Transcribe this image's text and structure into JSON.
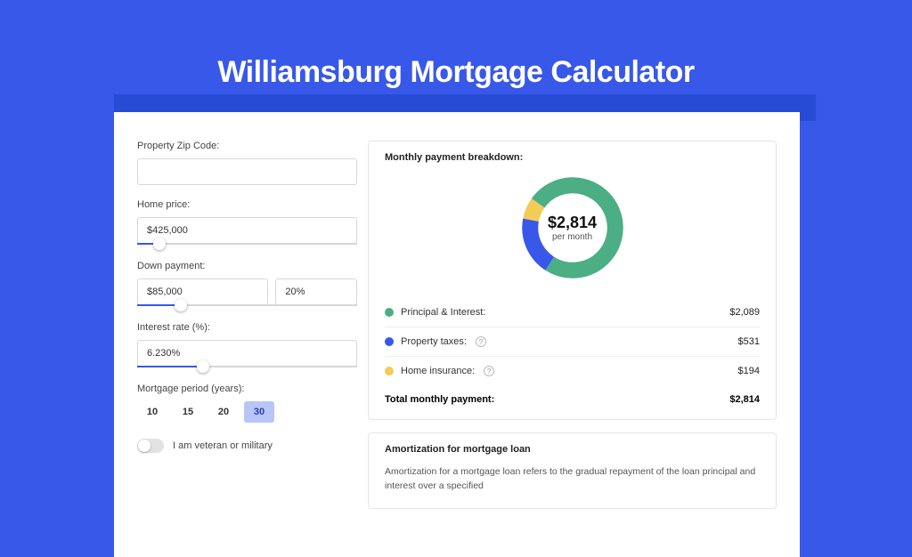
{
  "page_title": "Williamsburg Mortgage Calculator",
  "form": {
    "zip_label": "Property Zip Code:",
    "zip_value": "",
    "home_price_label": "Home price:",
    "home_price_value": "$425,000",
    "home_price_slider_pct": 10,
    "down_payment_label": "Down payment:",
    "down_payment_value": "$85,000",
    "down_payment_pct_value": "20%",
    "down_payment_slider_pct": 20,
    "interest_label": "Interest rate (%):",
    "interest_value": "6.230%",
    "interest_slider_pct": 30,
    "period_label": "Mortgage period (years):",
    "period_options": [
      "10",
      "15",
      "20",
      "30"
    ],
    "period_selected": "30",
    "veteran_label": "I am veteran or military"
  },
  "breakdown": {
    "title": "Monthly payment breakdown:",
    "donut_value": "$2,814",
    "donut_sub": "per month",
    "items": [
      {
        "label": "Principal & Interest:",
        "value": "$2,089",
        "color": "#4cae84",
        "info": false
      },
      {
        "label": "Property taxes:",
        "value": "$531",
        "color": "#3858e9",
        "info": true
      },
      {
        "label": "Home insurance:",
        "value": "$194",
        "color": "#f3cb57",
        "info": true
      }
    ],
    "total_label": "Total monthly payment:",
    "total_value": "$2,814"
  },
  "chart_data": {
    "type": "pie",
    "title": "Monthly payment breakdown",
    "series": [
      {
        "name": "Principal & Interest",
        "value": 2089,
        "color": "#4cae84"
      },
      {
        "name": "Property taxes",
        "value": 531,
        "color": "#3858e9"
      },
      {
        "name": "Home insurance",
        "value": 194,
        "color": "#f3cb57"
      }
    ],
    "total": 2814,
    "center_label": "$2,814",
    "center_sublabel": "per month"
  },
  "amortization": {
    "title": "Amortization for mortgage loan",
    "text": "Amortization for a mortgage loan refers to the gradual repayment of the loan principal and interest over a specified"
  }
}
